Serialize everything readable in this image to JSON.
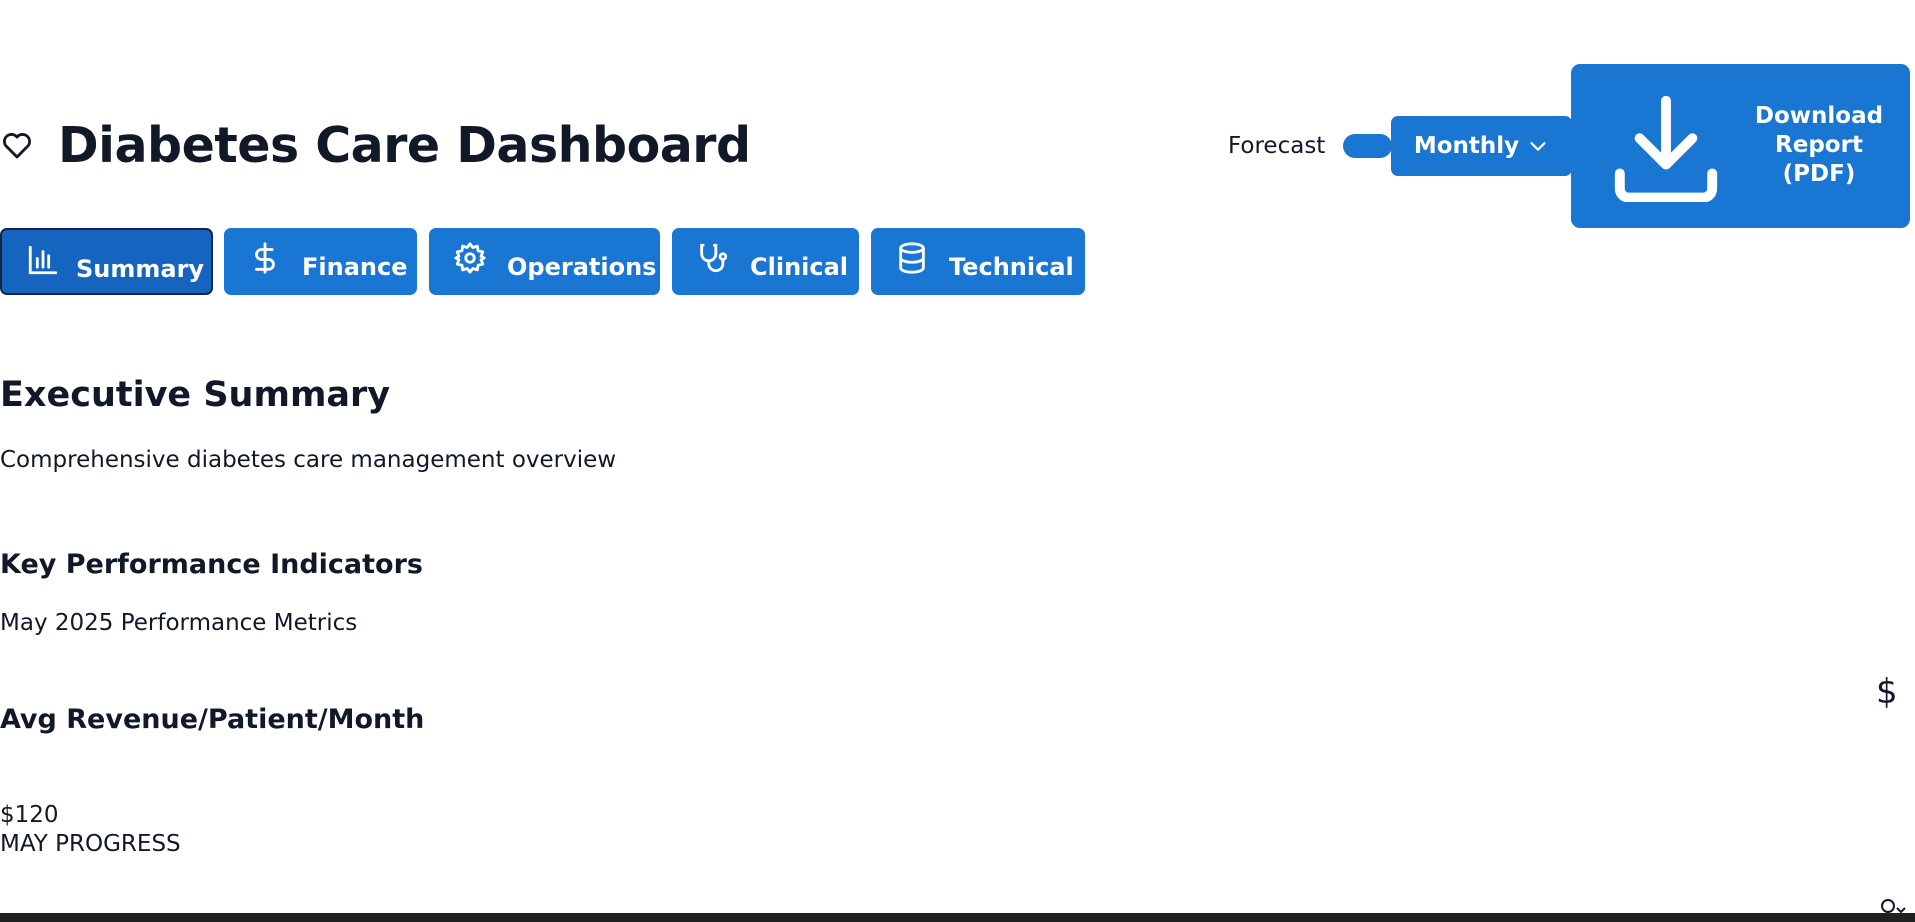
{
  "header": {
    "title": "Diabetes Care Dashboard",
    "forecast_label": "Forecast",
    "period_selected": "Monthly",
    "download_label": "Download Report (PDF)"
  },
  "tabs": [
    {
      "label": "Summary",
      "icon": "bar-chart-icon",
      "active": true
    },
    {
      "label": "Finance",
      "icon": "dollar-icon",
      "active": false
    },
    {
      "label": "Operations",
      "icon": "gear-icon",
      "active": false
    },
    {
      "label": "Clinical",
      "icon": "stethoscope-icon",
      "active": false
    },
    {
      "label": "Technical",
      "icon": "database-icon",
      "active": false
    }
  ],
  "summary": {
    "title": "Executive Summary",
    "subtitle": "Comprehensive diabetes care management overview"
  },
  "kpi": {
    "heading": "Key Performance Indicators",
    "period": "May 2025 Performance Metrics",
    "metric": {
      "title": "Avg Revenue/Patient/Month",
      "value": "$120",
      "progress_label": "MAY PROGRESS",
      "icon": "$"
    }
  },
  "colors": {
    "accent": "#1976d2",
    "accent_active": "#1565c0",
    "text": "#111827"
  }
}
